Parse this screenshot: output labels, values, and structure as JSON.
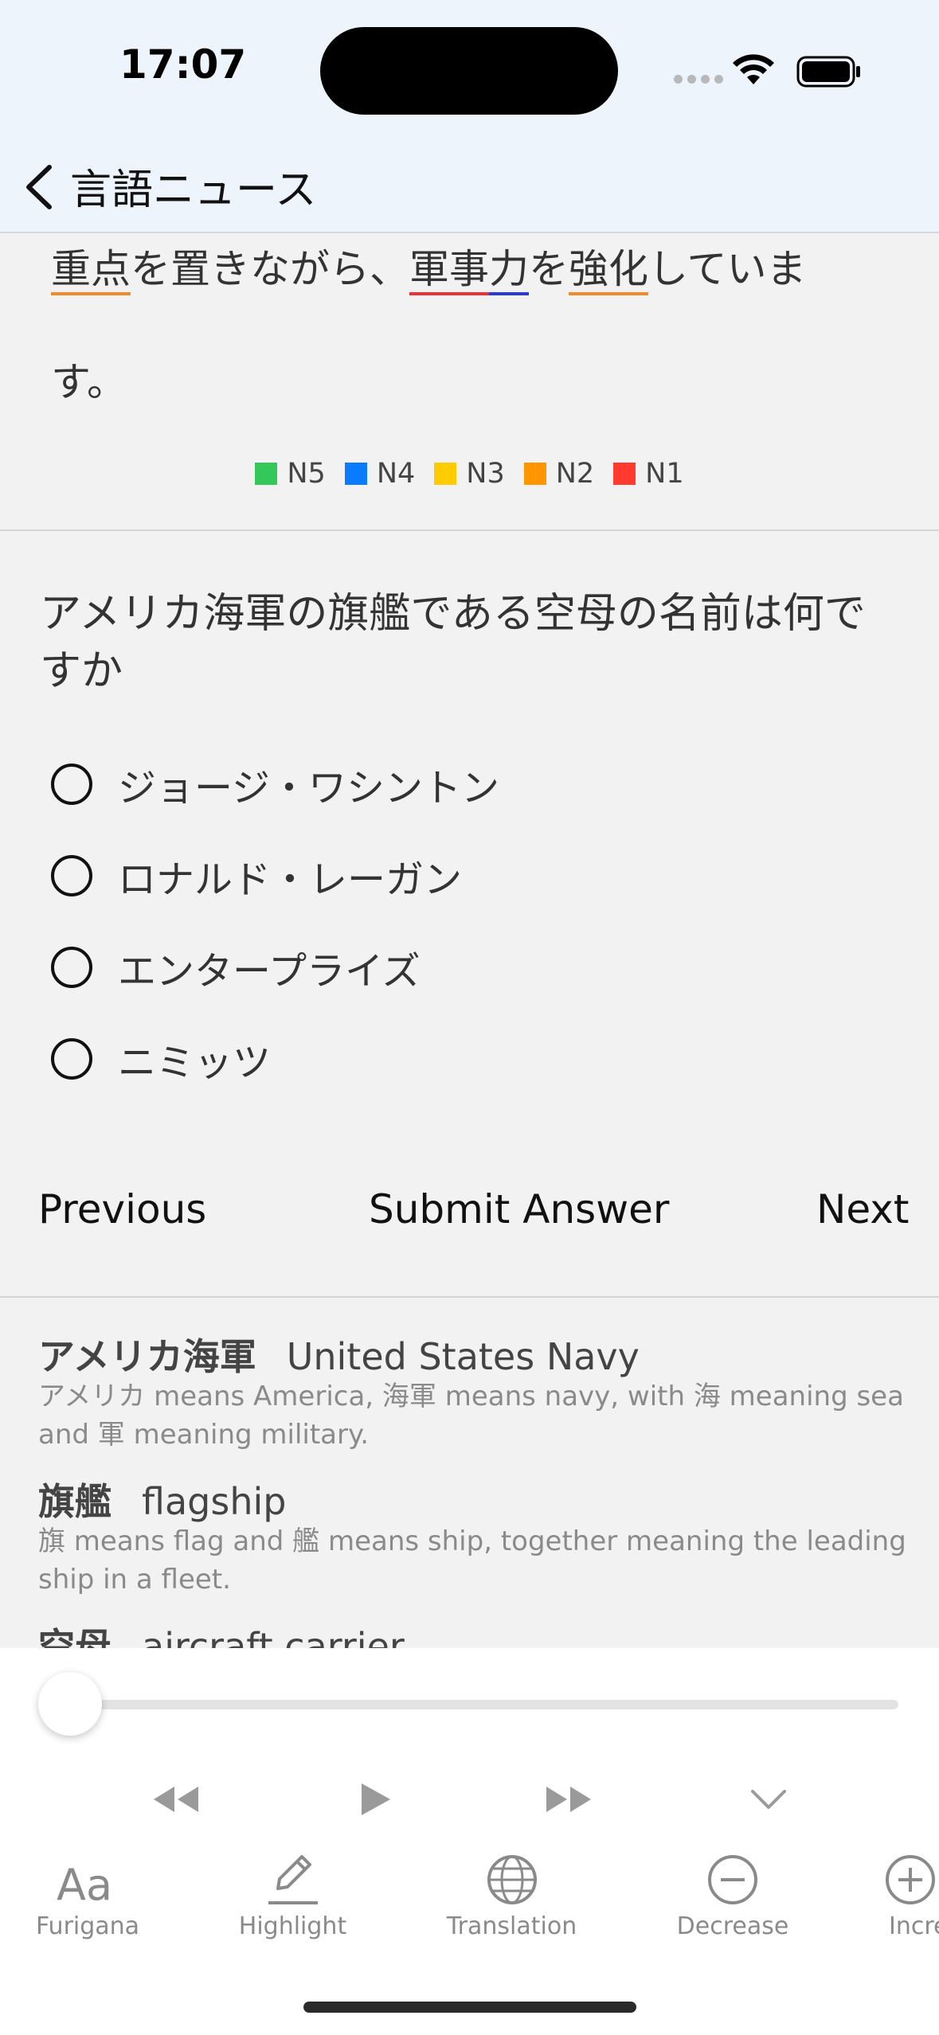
{
  "status_bar": {
    "time": "17:07"
  },
  "nav": {
    "title": "言語ニュース",
    "back_icon": "chevron-left-icon"
  },
  "article": {
    "line1": [
      {
        "text": "重点",
        "underline": "orange"
      },
      {
        "text": "を置きながら、"
      },
      {
        "text": "軍事",
        "underline": "red"
      },
      {
        "text": "力",
        "underline": "blue"
      },
      {
        "text": "を"
      },
      {
        "text": "強化",
        "underline": "orange"
      },
      {
        "text": "していま"
      }
    ],
    "line2": "す。"
  },
  "legend": [
    {
      "label": "N5",
      "color": "#34c759"
    },
    {
      "label": "N4",
      "color": "#0a7aff"
    },
    {
      "label": "N3",
      "color": "#ffcc00"
    },
    {
      "label": "N2",
      "color": "#ff9500"
    },
    {
      "label": "N1",
      "color": "#ff3b30"
    }
  ],
  "quiz": {
    "question": "アメリカ海軍の旗艦である空母の名前は何ですか",
    "options": [
      "ジョージ・ワシントン",
      "ロナルド・レーガン",
      "エンタープライズ",
      "ニミッツ"
    ],
    "previous_label": "Previous",
    "submit_label": "Submit Answer",
    "next_label": "Next"
  },
  "vocab": [
    {
      "term": "アメリカ海軍",
      "meaning": "United States Navy",
      "note": "アメリカ means America, 海軍 means navy, with 海 meaning sea and 軍 meaning military."
    },
    {
      "term": "旗艦",
      "meaning": "flagship",
      "note": "旗 means flag and 艦 means ship, together meaning the leading ship in a fleet."
    },
    {
      "term": "空母",
      "meaning": "aircraft carrier"
    }
  ],
  "player": {
    "progress": 0.0,
    "controls": [
      "rewind-icon",
      "play-icon",
      "fast-forward-icon",
      "chevron-down-icon"
    ]
  },
  "toolbar": [
    {
      "label": "Furigana",
      "icon": "furigana-icon"
    },
    {
      "label": "Highlight",
      "icon": "pencil-icon"
    },
    {
      "label": "Translation",
      "icon": "globe-icon"
    },
    {
      "label": "Decrease",
      "icon": "minus-circle-icon"
    },
    {
      "label": "Incre",
      "icon": "plus-circle-icon"
    }
  ]
}
